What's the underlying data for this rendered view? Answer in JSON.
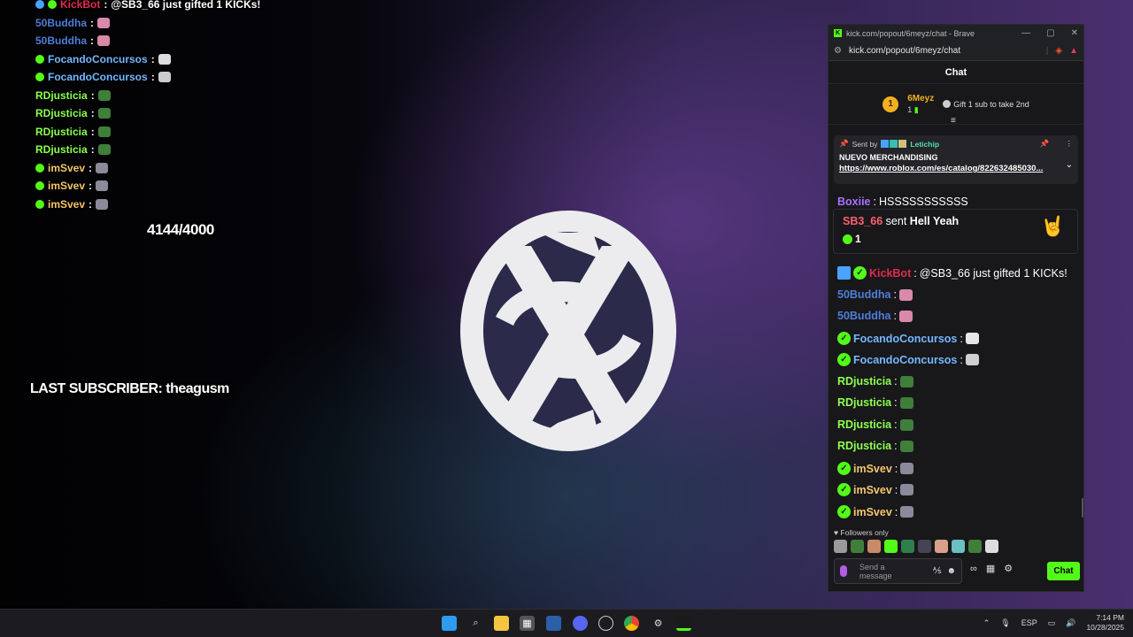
{
  "overlay": {
    "chat": [
      {
        "user": "KickBot",
        "sep": ":",
        "text": "@SB3_66 just gifted 1 KICKs!",
        "color": "#e02b4e",
        "badges": [
          "bot",
          "verified"
        ]
      },
      {
        "user": "50Buddha",
        "sep": ":",
        "text": "",
        "color": "#4d7ed8",
        "emote": "heart-emote",
        "emote_color": "#d98aa8"
      },
      {
        "user": "50Buddha",
        "sep": ":",
        "text": "",
        "color": "#4d7ed8",
        "emote": "heart-emote",
        "emote_color": "#d98aa8"
      },
      {
        "user": "FocandoConcursos",
        "sep": ":",
        "text": "",
        "color": "#74b7ff",
        "badges": [
          "verified"
        ],
        "emote": "cat-emote",
        "emote_color": "#dddddd"
      },
      {
        "user": "FocandoConcursos",
        "sep": ":",
        "text": "",
        "color": "#74b7ff",
        "badges": [
          "verified"
        ],
        "emote": "cat-emote",
        "emote_color": "#cccccc"
      },
      {
        "user": "RDjusticia",
        "sep": ":",
        "text": "",
        "color": "#8cff4f",
        "emote": "frog-emote",
        "emote_color": "#3f7f3a"
      },
      {
        "user": "RDjusticia",
        "sep": ":",
        "text": "",
        "color": "#8cff4f",
        "emote": "frog-emote",
        "emote_color": "#3f7f3a"
      },
      {
        "user": "RDjusticia",
        "sep": ":",
        "text": "",
        "color": "#8cff4f",
        "emote": "frog-emote",
        "emote_color": "#3f7f3a"
      },
      {
        "user": "RDjusticia",
        "sep": ":",
        "text": "",
        "color": "#8cff4f",
        "emote": "frog-emote",
        "emote_color": "#3f7f3a"
      },
      {
        "user": "imSvev",
        "sep": ":",
        "text": "",
        "color": "#f5c66a",
        "badges": [
          "verified"
        ],
        "emote": "gamer-emote",
        "emote_color": "#8a8a9a"
      },
      {
        "user": "imSvev",
        "sep": ":",
        "text": "",
        "color": "#f5c66a",
        "badges": [
          "verified"
        ],
        "emote": "gamer-emote",
        "emote_color": "#8a8a9a"
      },
      {
        "user": "imSvev",
        "sep": ":",
        "text": "",
        "color": "#f5c66a",
        "badges": [
          "verified"
        ],
        "emote": "gamer-emote",
        "emote_color": "#8a8a9a"
      }
    ],
    "sub_count": "4144/4000",
    "last_subscriber": "LAST SUBSCRIBER: theagusm"
  },
  "browser": {
    "window_title": "kick.com/popout/6meyz/chat - Brave",
    "url": "kick.com/popout/6meyz/chat",
    "chat_title": "Chat"
  },
  "leaderboard": {
    "rank": "1",
    "name": "6Meyz",
    "count": "1",
    "gift_hint": "Gift 1 sub to take 2nd"
  },
  "pinned": {
    "sent_by_label": "Sent by",
    "sender": "Letichip",
    "title": "NUEVO MERCHANDISING",
    "link": "https://www.roblox.com/es/catalog/822632485030..."
  },
  "gift_card": {
    "user": "SB3_66",
    "action": "sent",
    "item": "Hell Yeah",
    "count": "1"
  },
  "messages": [
    {
      "user": "Boxiie",
      "text": "HSSSSSSSSSSS",
      "color": "#a970ff",
      "verified": false
    },
    {
      "user": "KickBot",
      "text": "@SB3_66 just gifted 1 KICKs!",
      "color": "#e02b4e",
      "verified": true,
      "bot": true
    },
    {
      "user": "50Buddha",
      "text": "",
      "color": "#4d7ed8",
      "verified": false,
      "emote_color": "#d98aa8"
    },
    {
      "user": "50Buddha",
      "text": "",
      "color": "#4d7ed8",
      "verified": false,
      "emote_color": "#d98aa8"
    },
    {
      "user": "FocandoConcursos",
      "text": "",
      "color": "#74b7ff",
      "verified": true,
      "emote_color": "#e6e6e6"
    },
    {
      "user": "FocandoConcursos",
      "text": "",
      "color": "#74b7ff",
      "verified": true,
      "emote_color": "#cfcfcf"
    },
    {
      "user": "RDjusticia",
      "text": "",
      "color": "#8cff4f",
      "verified": false,
      "emote_color": "#3f7f3a"
    },
    {
      "user": "RDjusticia",
      "text": "",
      "color": "#8cff4f",
      "verified": false,
      "emote_color": "#3f7f3a"
    },
    {
      "user": "RDjusticia",
      "text": "",
      "color": "#8cff4f",
      "verified": false,
      "emote_color": "#3f7f3a"
    },
    {
      "user": "RDjusticia",
      "text": "",
      "color": "#8cff4f",
      "verified": false,
      "emote_color": "#3f7f3a"
    },
    {
      "user": "imSvev",
      "text": "",
      "color": "#f5c66a",
      "verified": true,
      "emote_color": "#8a8a9a"
    },
    {
      "user": "imSvev",
      "text": "",
      "color": "#f5c66a",
      "verified": true,
      "emote_color": "#8a8a9a"
    },
    {
      "user": "imSvev",
      "text": "",
      "color": "#f5c66a",
      "verified": true,
      "emote_color": "#8a8a9a"
    }
  ],
  "chat_mode": "Followers only",
  "quick_emotes": [
    "#9a9a9a",
    "#3f7f3a",
    "#c98a6a",
    "#53fc18",
    "#2e7f4a",
    "#444455",
    "#d9a08a",
    "#6ac0c0",
    "#3f7f3a",
    "#dddddd"
  ],
  "input": {
    "placeholder": "Send a message",
    "send_label": "Chat"
  },
  "taskbar": {
    "lang": "ESP",
    "time": "7:14 PM",
    "date": "10/28/2025"
  },
  "colors": {
    "kick_green": "#53fc18",
    "panel_bg": "#18181b"
  }
}
